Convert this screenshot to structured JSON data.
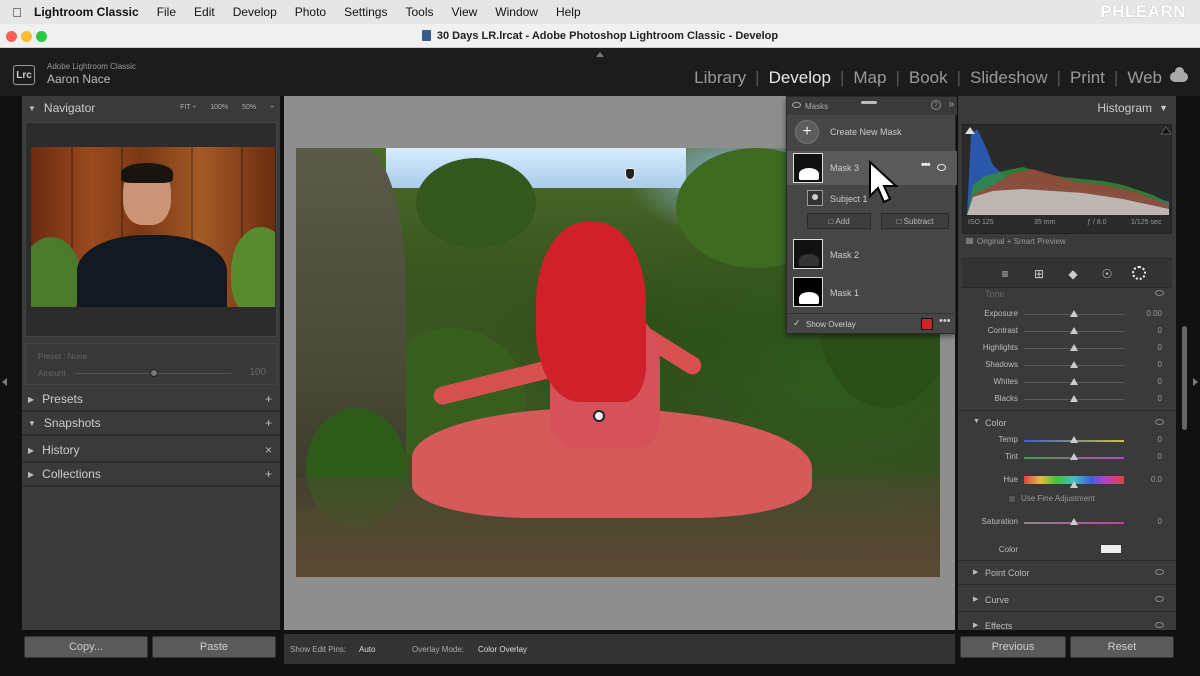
{
  "menubar": {
    "app_name": "Lightroom Classic",
    "items": [
      "File",
      "Edit",
      "Develop",
      "Photo",
      "Settings",
      "Tools",
      "View",
      "Window",
      "Help"
    ],
    "brand": "PHLEARN"
  },
  "window": {
    "title": "30 Days LR.lrcat - Adobe Photoshop Lightroom Classic - Develop"
  },
  "identity": {
    "logo": "Lrc",
    "app_subtitle": "Adobe Lightroom Classic",
    "user": "Aaron Nace"
  },
  "modules": [
    "Library",
    "Develop",
    "Map",
    "Book",
    "Slideshow",
    "Print",
    "Web"
  ],
  "active_module": "Develop",
  "navigator": {
    "title": "Navigator",
    "options": [
      "FIT ÷",
      "100%",
      "50%",
      "÷"
    ]
  },
  "preset": {
    "label": "Preset : None",
    "amount_label": "Amount",
    "amount_value": "100",
    "amount_fraction": 0.5
  },
  "left_sections": [
    {
      "name": "Presets",
      "action": "+"
    },
    {
      "name": "Snapshots",
      "action": "+"
    },
    {
      "name": "History",
      "action": "×"
    },
    {
      "name": "Collections",
      "action": "+"
    }
  ],
  "left_buttons": {
    "copy": "Copy...",
    "paste": "Paste"
  },
  "masks_panel": {
    "title": "Masks",
    "help": "?",
    "create_label": "Create New Mask",
    "masks": [
      {
        "name": "Mask 3",
        "selected": true
      },
      {
        "name": "Mask 2",
        "selected": false
      },
      {
        "name": "Mask 1",
        "selected": false
      }
    ],
    "component": "Subject 1",
    "add_label": "Add",
    "subtract_label": "Subtract",
    "show_overlay_label": "Show Overlay",
    "overlay_color": "#d32222"
  },
  "toolbar": {
    "edit_pins_label": "Show Edit Pins:",
    "edit_pins_value": "Auto",
    "overlay_mode_label": "Overlay Mode:",
    "overlay_mode_value": "Color Overlay"
  },
  "histogram": {
    "title": "Histogram",
    "iso": "ISO 125",
    "focal": "35 mm",
    "aperture": "ƒ / 8.0",
    "shutter": "1/125 sec",
    "preview_label": "Original + Smart Preview"
  },
  "tone": {
    "title": "Tone",
    "sliders": [
      {
        "label": "Exposure",
        "value": "0.00"
      },
      {
        "label": "Contrast",
        "value": "0"
      },
      {
        "label": "Highlights",
        "value": "0"
      },
      {
        "label": "Shadows",
        "value": "0"
      },
      {
        "label": "Whites",
        "value": "0"
      },
      {
        "label": "Blacks",
        "value": "0"
      }
    ]
  },
  "color": {
    "title": "Color",
    "temp": {
      "label": "Temp",
      "value": "0"
    },
    "tint": {
      "label": "Tint",
      "value": "0"
    },
    "hue": {
      "label": "Hue",
      "value": "0.0"
    },
    "fine_label": "Use Fine Adjustment",
    "saturation": {
      "label": "Saturation",
      "value": "0"
    },
    "color_label": "Color"
  },
  "collapsed_sections": [
    "Point Color",
    "Curve",
    "Effects"
  ],
  "right_buttons": {
    "previous": "Previous",
    "reset": "Reset"
  }
}
